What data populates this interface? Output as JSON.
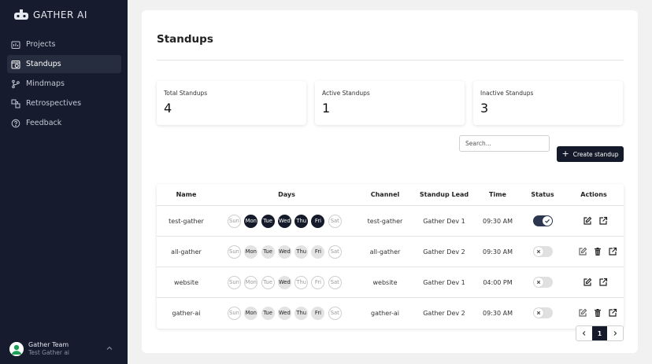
{
  "sidebar": {
    "brand": "GATHER AI",
    "items": [
      {
        "label": "Projects",
        "icon": "projects-icon"
      },
      {
        "label": "Standups",
        "icon": "standups-icon"
      },
      {
        "label": "Mindmaps",
        "icon": "mindmaps-icon"
      },
      {
        "label": "Retrospectives",
        "icon": "retrospectives-icon"
      },
      {
        "label": "Feedback",
        "icon": "feedback-icon"
      }
    ],
    "active": "Standups",
    "user": {
      "name": "Gather Team",
      "subtitle": "Test Gather ai"
    }
  },
  "page": {
    "title": "Standups"
  },
  "stats": [
    {
      "label": "Total Standups",
      "value": "4"
    },
    {
      "label": "Active Standups",
      "value": "1"
    },
    {
      "label": "Inactive Standups",
      "value": "3"
    }
  ],
  "search": {
    "placeholder": "Search..."
  },
  "create_button": {
    "label": "Create standup"
  },
  "table": {
    "headers": [
      "Name",
      "Days",
      "Channel",
      "Standup Lead",
      "Time",
      "Status",
      "Actions"
    ],
    "rows": [
      {
        "name": "test-gather",
        "days": [
          "Sun",
          "Mon",
          "Tue",
          "Wed",
          "Thu",
          "Fri",
          "Sat"
        ],
        "day_state": [
          "off",
          "on",
          "on",
          "on",
          "on",
          "on",
          "off"
        ],
        "channel": "test-gather",
        "lead": "Gather Dev 1",
        "time": "09:30 AM",
        "active": true,
        "actions": [
          "edit-icon",
          "open-external-icon"
        ]
      },
      {
        "name": "all-gather",
        "days": [
          "Sun",
          "Mon",
          "Tue",
          "Wed",
          "Thu",
          "Fri",
          "Sat"
        ],
        "day_state": [
          "off",
          "mid",
          "mid",
          "mid",
          "mid",
          "mid",
          "off"
        ],
        "channel": "all-gather",
        "lead": "Gather Dev 2",
        "time": "09:30 AM",
        "active": false,
        "actions": [
          "edit-icon",
          "delete-icon",
          "open-external-icon"
        ]
      },
      {
        "name": "website",
        "days": [
          "Sun",
          "Mon",
          "Tue",
          "Wed",
          "Thu",
          "Fri",
          "Sat"
        ],
        "day_state": [
          "off",
          "off",
          "off",
          "mid",
          "off",
          "off",
          "off"
        ],
        "channel": "website",
        "lead": "Gather Dev 1",
        "time": "04:00 PM",
        "active": false,
        "actions": [
          "edit-icon",
          "open-external-icon"
        ]
      },
      {
        "name": "gather-ai",
        "days": [
          "Sun",
          "Mon",
          "Tue",
          "Wed",
          "Thu",
          "Fri",
          "Sat"
        ],
        "day_state": [
          "off",
          "mid",
          "mid",
          "mid",
          "mid",
          "mid",
          "off"
        ],
        "channel": "gather-ai",
        "lead": "Gather Dev 2",
        "time": "09:30 AM",
        "active": false,
        "actions": [
          "edit-icon",
          "delete-icon",
          "open-external-icon"
        ]
      }
    ]
  },
  "pagination": {
    "current": "1"
  },
  "colors": {
    "sidebar_bg": "#161c2d",
    "accent": "#141a2a",
    "active_day": "#141a2a"
  }
}
